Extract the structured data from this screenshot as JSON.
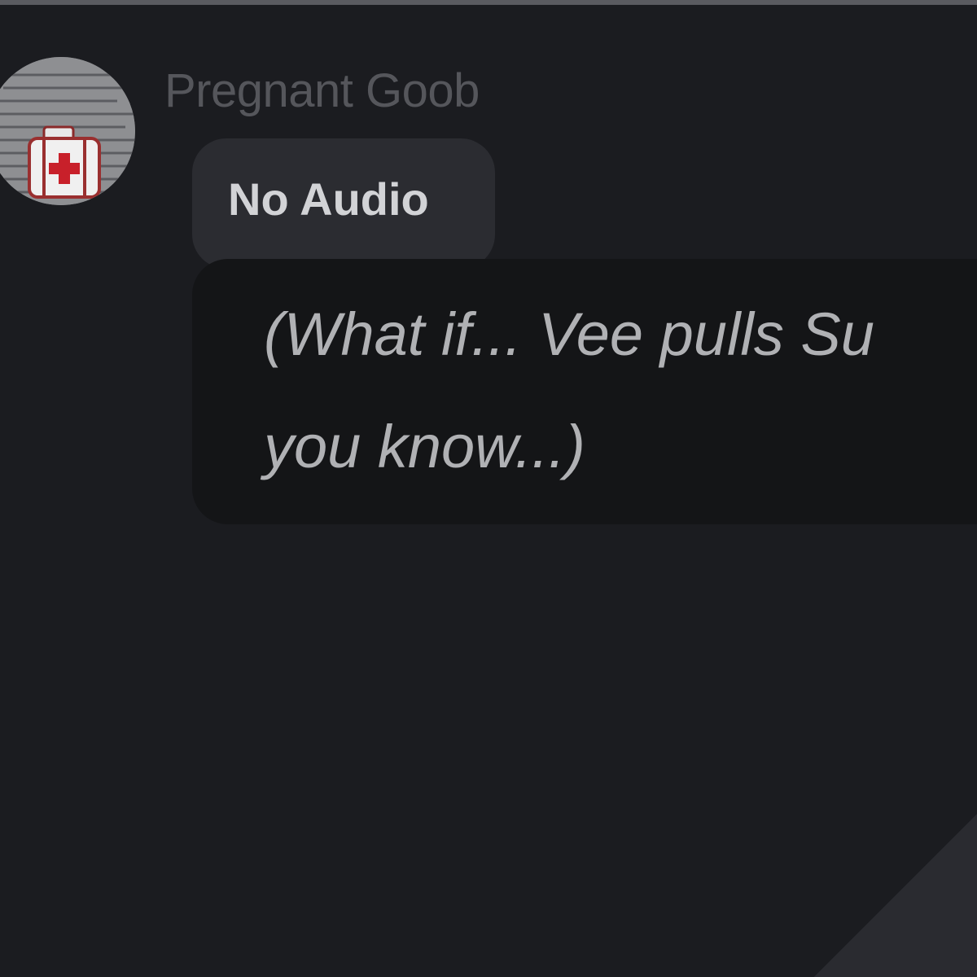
{
  "message": {
    "author": "Pregnant Goob",
    "tag": "No Audio",
    "lines": [
      "(What if... Vee pulls Su",
      "you know...)"
    ]
  },
  "avatar": {
    "icon": "medical-kit-icon"
  },
  "colors": {
    "background": "#1b1c20",
    "tag_background": "#2b2c31",
    "bubble_background": "#141517",
    "author_text": "#55565b",
    "message_text": "#b0b1b4",
    "accent_red": "#c8202a"
  }
}
